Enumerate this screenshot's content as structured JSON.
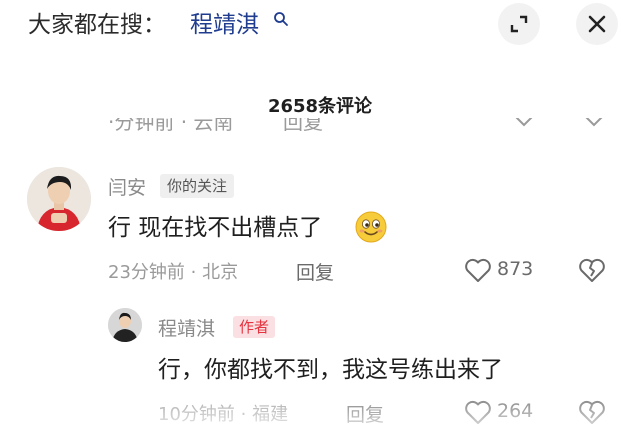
{
  "search_bar": {
    "prefix": "大家都在搜：",
    "term": "程靖淇"
  },
  "comments_header": {
    "count_label": "2658条评论"
  },
  "previous_comment_partial": {
    "meta": "·分钟前 · 云南",
    "reply": "回复"
  },
  "comments": [
    {
      "username": "闫安",
      "tag": "你的关注",
      "text": "行 现在找不出槽点了",
      "emoji": "grinning-face-emoji",
      "meta": "23分钟前 · 北京",
      "reply": "回复",
      "likes": "873"
    }
  ],
  "replies": [
    {
      "username": "程靖淇",
      "tag": "作者",
      "text": "行，你都找不到，我这号练出来了",
      "meta": "10分钟前 · 福建",
      "reply": "回复",
      "likes": "264"
    }
  ],
  "colors": {
    "search_term": "#1f3c8f",
    "author_tag_bg": "#fbe0e3",
    "author_tag_text": "#e5333f",
    "meta_gray": "#9a9a9a"
  },
  "icons": {
    "search": "search-icon",
    "expand": "expand-icon",
    "close": "close-icon",
    "like": "heart-icon",
    "dislike": "broken-heart-icon"
  }
}
